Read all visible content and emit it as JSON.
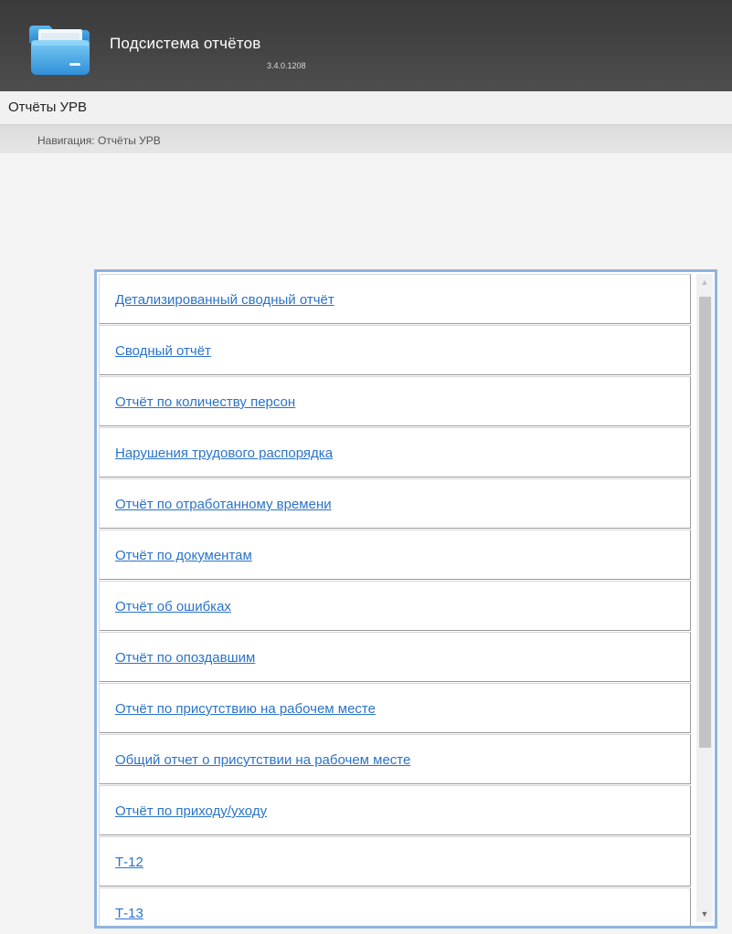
{
  "app": {
    "title": "Подсистема отчётов",
    "version": "3.4.0.1208",
    "icon": "folder-icon"
  },
  "section": {
    "title": "Отчёты УРВ"
  },
  "breadcrumb": {
    "text": "Навигация: Отчёты УРВ"
  },
  "reports": [
    {
      "label": "Детализированный сводный отчёт"
    },
    {
      "label": "Сводный отчёт"
    },
    {
      "label": "Отчёт по количеству персон"
    },
    {
      "label": "Нарушения трудового распорядка"
    },
    {
      "label": "Отчёт по отработанному времени"
    },
    {
      "label": "Отчёт по документам"
    },
    {
      "label": "Отчёт об ошибках"
    },
    {
      "label": "Отчёт по опоздавшим"
    },
    {
      "label": "Отчёт по присутствию на рабочем месте"
    },
    {
      "label": "Общий отчет о присутствии на рабочем месте"
    },
    {
      "label": "Отчёт по приходу/уходу"
    },
    {
      "label": "Т-12"
    },
    {
      "label": "Т-13"
    }
  ],
  "scroll": {
    "up_icon": "arrow-up-icon",
    "down_icon": "arrow-down-icon"
  },
  "colors": {
    "header_bg": "#444444",
    "link": "#2a73c7",
    "panel_border": "#8fb3de"
  }
}
